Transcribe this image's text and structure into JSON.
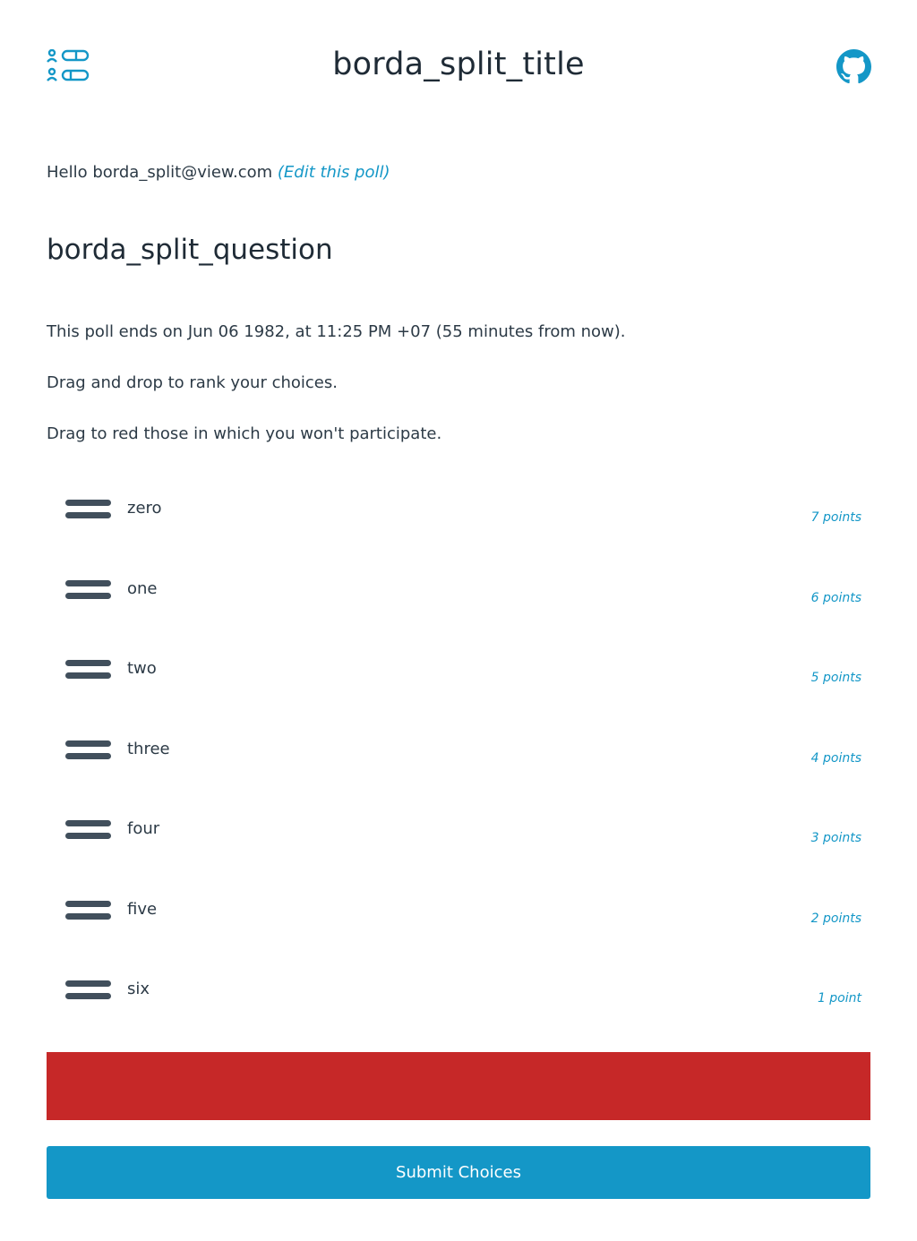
{
  "header": {
    "title": "borda_split_title",
    "logo_icon": "poll-logo-icon",
    "github_icon": "github-icon"
  },
  "greeting": {
    "prefix": "Hello borda_split@view.com",
    "edit_link": "(Edit this poll)"
  },
  "poll": {
    "question": "borda_split_question",
    "end_text": "This poll ends on Jun 06 1982, at 11:25 PM +07 (55 minutes from now).",
    "instruction_rank": "Drag and drop to rank your choices.",
    "instruction_reject": "Drag to red those in which you won't participate.",
    "choices": [
      {
        "label": "zero",
        "points": "7 points"
      },
      {
        "label": "one",
        "points": "6 points"
      },
      {
        "label": "two",
        "points": "5 points"
      },
      {
        "label": "three",
        "points": "4 points"
      },
      {
        "label": "four",
        "points": "3 points"
      },
      {
        "label": "five",
        "points": "2 points"
      },
      {
        "label": "six",
        "points": "1 point"
      }
    ]
  },
  "colors": {
    "accent": "#1497c7",
    "reject_zone": "#c62828",
    "text": "#2c3a46"
  },
  "actions": {
    "submit_label": "Submit Choices"
  }
}
